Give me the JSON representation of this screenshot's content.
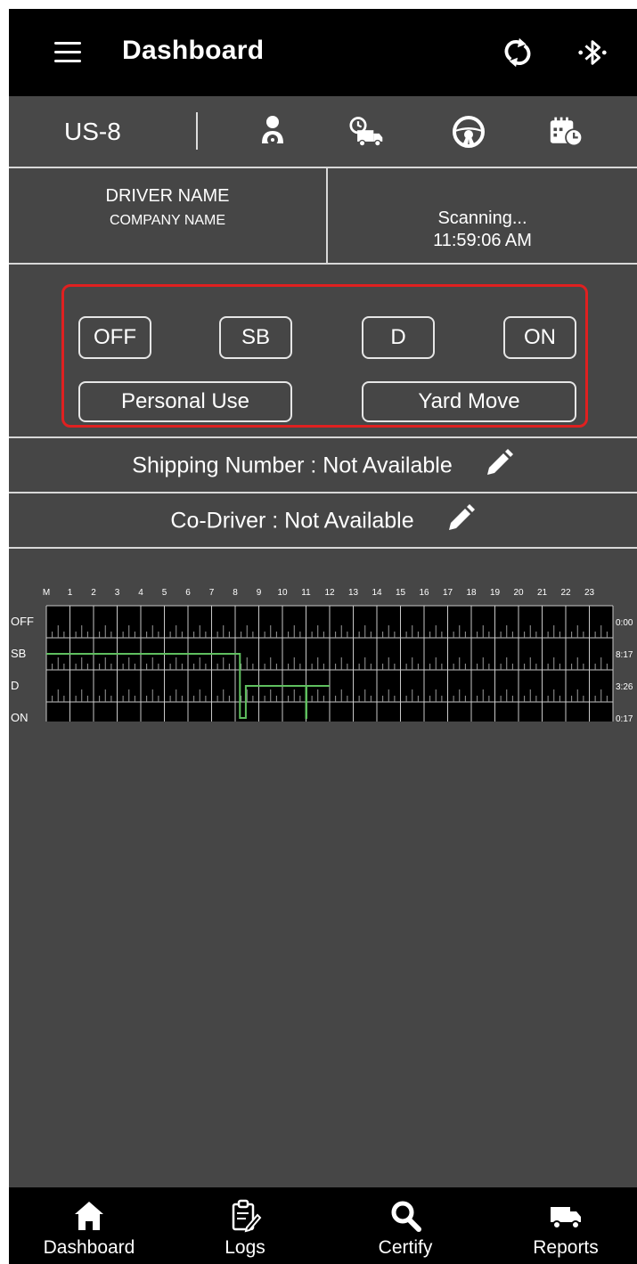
{
  "header": {
    "title": "Dashboard",
    "menu_icon": "hamburger-menu-icon",
    "sync_icon": "sync-icon",
    "bluetooth_icon": "bluetooth-icon"
  },
  "status_bar": {
    "rule_set": "US-8",
    "icons": [
      "driver-icon",
      "truck-clock-icon",
      "steering-wheel-icon",
      "calendar-clock-icon"
    ]
  },
  "driver": {
    "name": "DRIVER NAME",
    "company": "COMPANY NAME",
    "connection_status": "Scanning...",
    "time": "11:59:06 AM"
  },
  "duty_status": {
    "off": "OFF",
    "sb": "SB",
    "d": "D",
    "on": "ON",
    "personal_use": "Personal Use",
    "yard_move": "Yard Move"
  },
  "shipping": {
    "text": "Shipping Number : Not Available"
  },
  "codriver": {
    "text": "Co-Driver : Not Available"
  },
  "log_graph": {
    "hour_labels": [
      "M",
      "1",
      "2",
      "3",
      "4",
      "5",
      "6",
      "7",
      "8",
      "9",
      "10",
      "11",
      "12",
      "13",
      "14",
      "15",
      "16",
      "17",
      "18",
      "19",
      "20",
      "21",
      "22",
      "23"
    ],
    "row_labels": [
      "OFF",
      "SB",
      "D",
      "ON"
    ],
    "totals": [
      "0:00",
      "8:17",
      "3:26",
      "0:17"
    ],
    "current_time_fragment": "11:5",
    "line_color": "#5fbf5f",
    "segments": [
      {
        "status": "SB",
        "start_hour": 0,
        "end_hour": 8.2
      },
      {
        "status": "ON",
        "start_hour": 8.2,
        "end_hour": 8.45
      },
      {
        "status": "D",
        "start_hour": 8.45,
        "end_hour": 11.0
      },
      {
        "status": "ON",
        "start_hour": 11.0,
        "end_hour": 11.02
      },
      {
        "status": "D",
        "start_hour": 11.02,
        "end_hour": 12.0
      }
    ]
  },
  "bottom_nav": [
    {
      "label": "Dashboard",
      "icon": "home-icon"
    },
    {
      "label": "Logs",
      "icon": "logs-clipboard-icon"
    },
    {
      "label": "Certify",
      "icon": "search-icon"
    },
    {
      "label": "Reports",
      "icon": "truck-icon"
    }
  ]
}
